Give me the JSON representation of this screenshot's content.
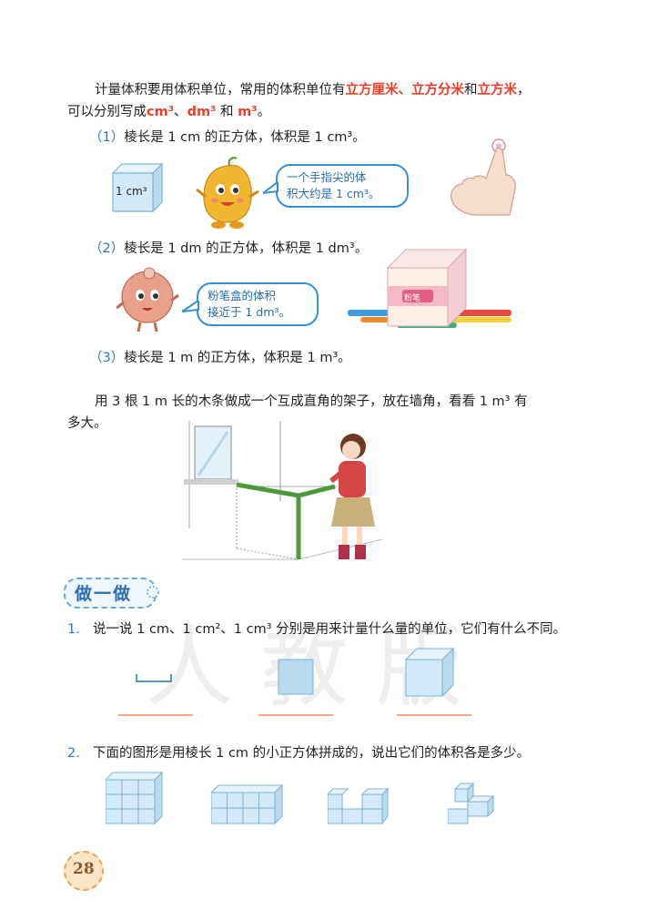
{
  "intro": {
    "lead": "计量体积要用体积单位，常用的体积单位有",
    "unit1": "立方厘米",
    "sep1": "、",
    "unit2": "立方分米",
    "and1": "和",
    "unit3": "立方米",
    "tail": "，",
    "line2_lead": "可以分别写成",
    "abbr1": "cm³",
    "sep2": "、",
    "abbr2": "dm³",
    "and2": " 和 ",
    "abbr3": "m³",
    "end": "。"
  },
  "items": [
    {
      "num": "（1）",
      "text": "棱长是 1 cm 的正方体，体积是 1 cm³。"
    },
    {
      "num": "（2）",
      "text": "棱长是 1 dm 的正方体，体积是 1 dm³。"
    },
    {
      "num": "（3）",
      "text": "棱长是 1 m 的正方体，体积是 1 m³。"
    }
  ],
  "cube1_label": "1 cm³",
  "bubble1": [
    "一个手指尖的体",
    "积大约是 1 cm³。"
  ],
  "bubble2": [
    "粉笔盒的体积",
    "接近于 1 dm³。"
  ],
  "chalk_box_label": "粉笔",
  "para2": [
    "用 3 根 1 m 长的木条做成一个互成直角的架子，放在墙角，看看 1 m³ 有",
    "多大。"
  ],
  "section_title": "做一做",
  "q1": {
    "num": "1.",
    "text": "说一说 1 cm、1 cm²、1 cm³ 分别是用来计量什么量的单位，它们有什么不同。"
  },
  "q2": {
    "num": "2.",
    "text": "下面的图形是用棱长 1 cm 的小正方体拼成的，说出它们的体积各是多少。"
  },
  "page_number": "28",
  "colors": {
    "accent_red": "#e8412b",
    "accent_blue": "#2b7bc0",
    "cube_fill": "#cfe6f5",
    "answer_line": "#f3a783"
  }
}
